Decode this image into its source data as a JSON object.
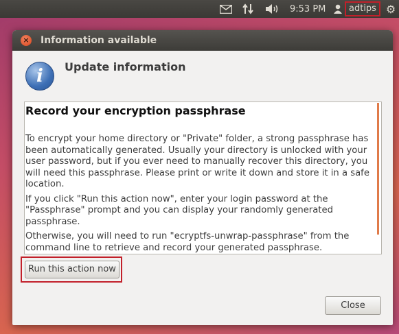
{
  "top_panel": {
    "time": "9:53 PM",
    "user": "adtips",
    "icons": [
      "mail-icon",
      "network-icon",
      "volume-icon",
      "user-icon",
      "gear-icon"
    ]
  },
  "dialog": {
    "title": "Information available",
    "heading": "Update information",
    "panel_title": "Record your encryption passphrase",
    "paragraphs": [
      "To encrypt your home directory or \"Private\" folder, a strong passphrase has been automatically generated. Usually your directory is unlocked with your user password, but if you ever need to manually recover this directory, you will need this passphrase. Please print or write it down and store it in a safe location.",
      "If you click \"Run this action now\", enter your login password at the \"Passphrase\" prompt and you can display your randomly generated passphrase.",
      "Otherwise, you will need to run \"ecryptfs-unwrap-passphrase\" from the command line to retrieve and record your generated passphrase."
    ],
    "run_button": "Run this action now",
    "close_button": "Close"
  },
  "colors": {
    "highlight": "#c2202a",
    "accent": "#e07b4a",
    "panel": "#3d3c38"
  }
}
